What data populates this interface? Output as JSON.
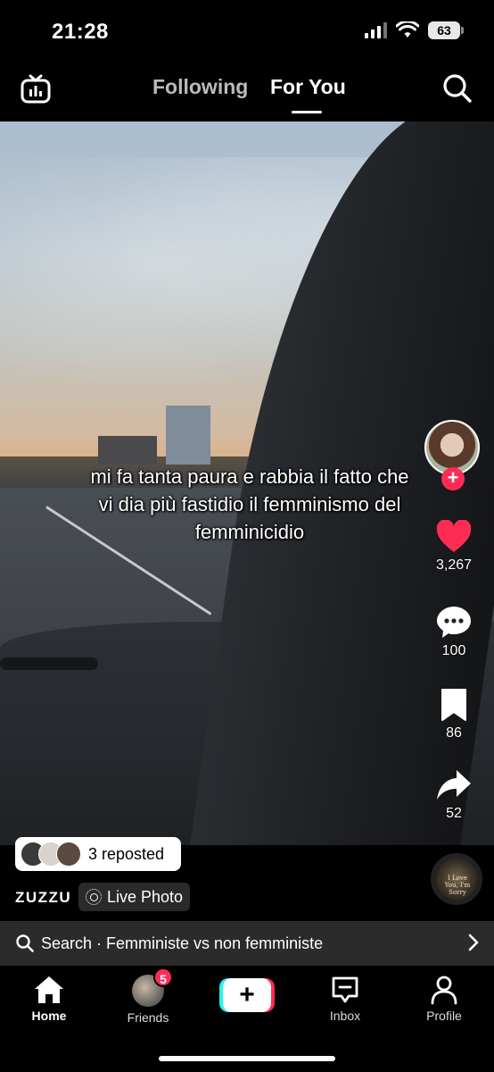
{
  "status": {
    "time": "21:28",
    "battery": "63"
  },
  "topnav": {
    "tabs": [
      "Following",
      "For You"
    ],
    "active": "For You"
  },
  "video": {
    "caption": "mi fa tanta paura e rabbia il fatto che vi dia più fastidio il femminismo del femminicidio"
  },
  "rail": {
    "likes": "3,267",
    "comments": "100",
    "saves": "86",
    "shares": "52"
  },
  "repost": {
    "label": "3 reposted"
  },
  "author": {
    "name": "ZUZZU",
    "tag": "Live Photo"
  },
  "music": {
    "disc_text": "I Love You, I'm Sorry"
  },
  "search": {
    "text": "Search · Femministe vs non femministe"
  },
  "bottomnav": {
    "home": "Home",
    "friends": "Friends",
    "friends_badge": "5",
    "create": "+",
    "inbox": "Inbox",
    "profile": "Profile"
  },
  "colors": {
    "accent": "#fe2c55",
    "cyan": "#25f4ee",
    "background": "#000000"
  }
}
